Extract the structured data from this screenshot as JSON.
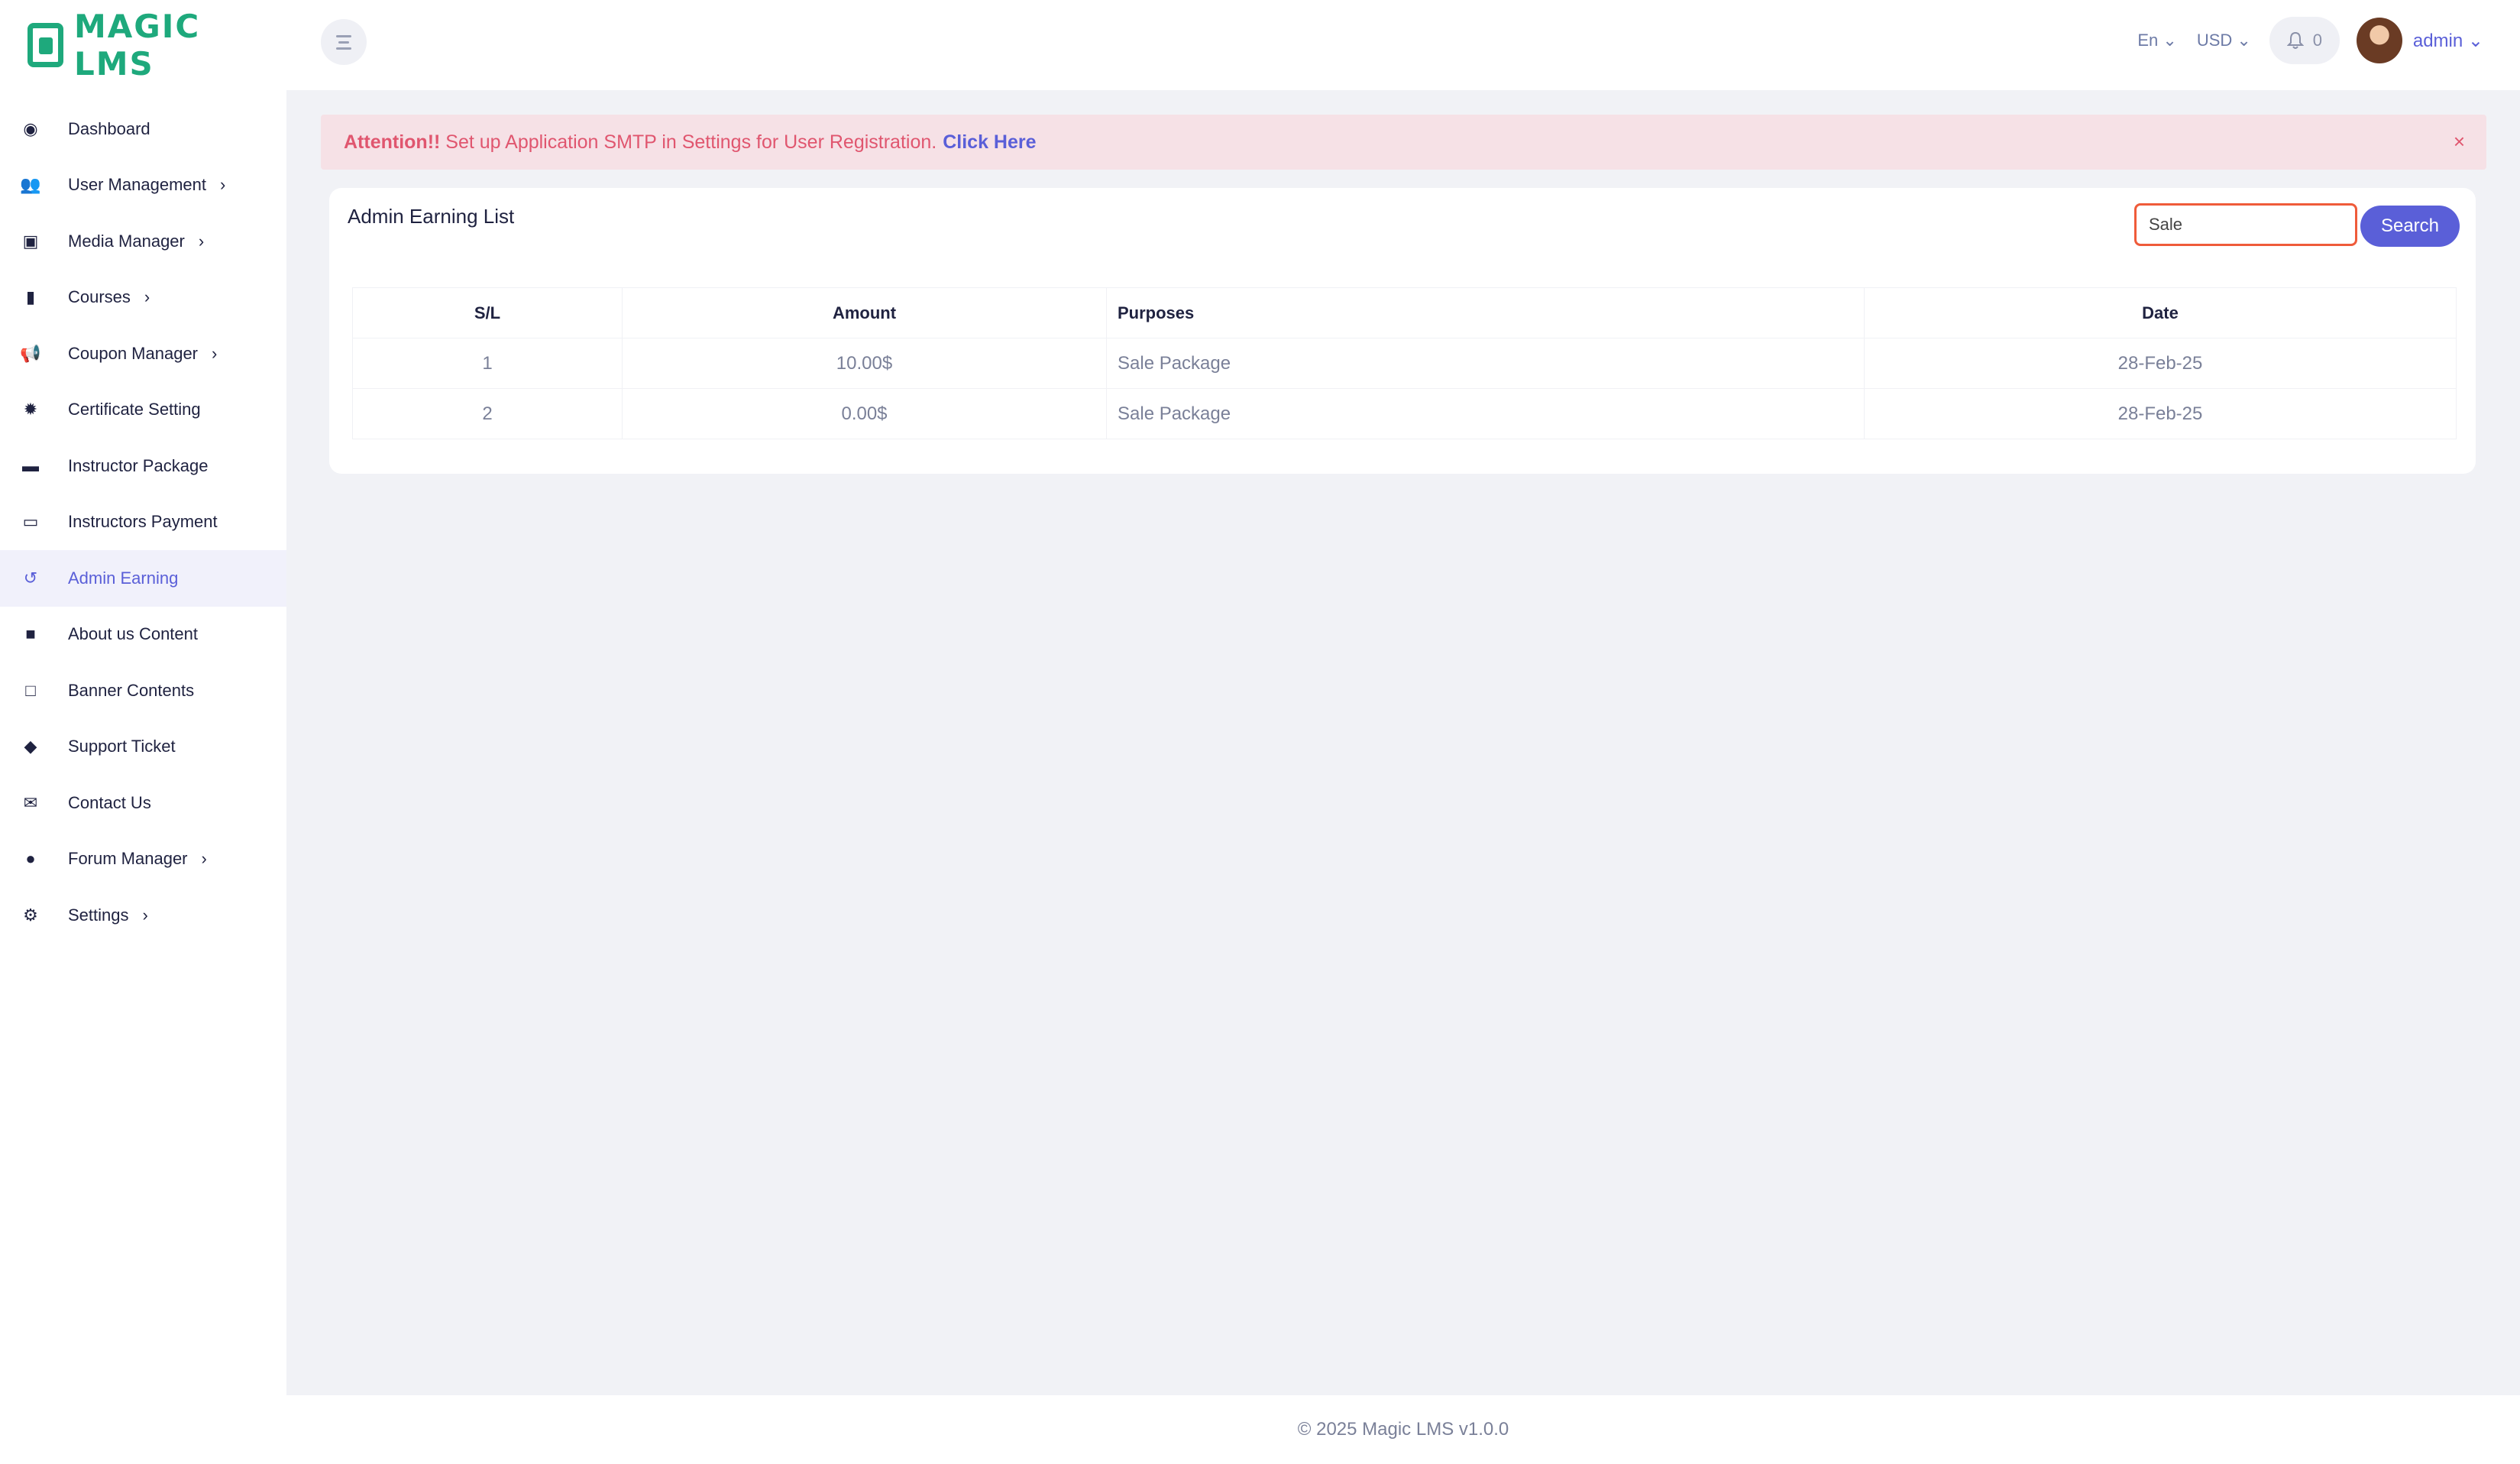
{
  "brand": {
    "name": "MAGIC LMS",
    "color": "#1ea97c"
  },
  "sidebar": {
    "items": [
      {
        "label": "Dashboard",
        "icon": "palette-icon",
        "has_submenu": false,
        "active": false
      },
      {
        "label": "User Management",
        "icon": "users-icon",
        "has_submenu": true,
        "active": false
      },
      {
        "label": "Media Manager",
        "icon": "image-icon",
        "has_submenu": true,
        "active": false
      },
      {
        "label": "Courses",
        "icon": "book-icon",
        "has_submenu": true,
        "active": false
      },
      {
        "label": "Coupon Manager",
        "icon": "megaphone-icon",
        "has_submenu": true,
        "active": false
      },
      {
        "label": "Certificate Setting",
        "icon": "certificate-icon",
        "has_submenu": false,
        "active": false
      },
      {
        "label": "Instructor Package",
        "icon": "briefcase-icon",
        "has_submenu": false,
        "active": false
      },
      {
        "label": "Instructors Payment",
        "icon": "money-icon",
        "has_submenu": false,
        "active": false
      },
      {
        "label": "Admin Earning",
        "icon": "history-icon",
        "has_submenu": false,
        "active": true
      },
      {
        "label": "About us Content",
        "icon": "note-icon",
        "has_submenu": false,
        "active": false
      },
      {
        "label": "Banner Contents",
        "icon": "sticky-note-icon",
        "has_submenu": false,
        "active": false
      },
      {
        "label": "Support Ticket",
        "icon": "ticket-icon",
        "has_submenu": false,
        "active": false
      },
      {
        "label": "Contact Us",
        "icon": "envelope-open-icon",
        "has_submenu": false,
        "active": false
      },
      {
        "label": "Forum Manager",
        "icon": "question-circle-icon",
        "has_submenu": true,
        "active": false
      },
      {
        "label": "Settings",
        "icon": "gear-icon",
        "has_submenu": true,
        "active": false
      }
    ]
  },
  "header": {
    "language": "En",
    "currency": "USD",
    "notification_count": "0",
    "user_name": "admin"
  },
  "alert": {
    "strong": "Attention!!",
    "message": "Set up Application SMTP in Settings for User Registration.",
    "link_text": "Click Here",
    "close": "×"
  },
  "card": {
    "title": "Admin Earning List",
    "search_value": "Sale",
    "search_button": "Search",
    "columns": [
      "S/L",
      "Amount",
      "Purposes",
      "Date"
    ],
    "rows": [
      [
        "1",
        "10.00$",
        "Sale Package",
        "28-Feb-25"
      ],
      [
        "2",
        "0.00$",
        "Sale Package",
        "28-Feb-25"
      ]
    ]
  },
  "footer": {
    "text": "© 2025 Magic LMS v1.0.0"
  },
  "colors": {
    "accent": "#5a5fd8",
    "alert_bg": "#f6e1e6",
    "alert_text": "#e0566f"
  }
}
